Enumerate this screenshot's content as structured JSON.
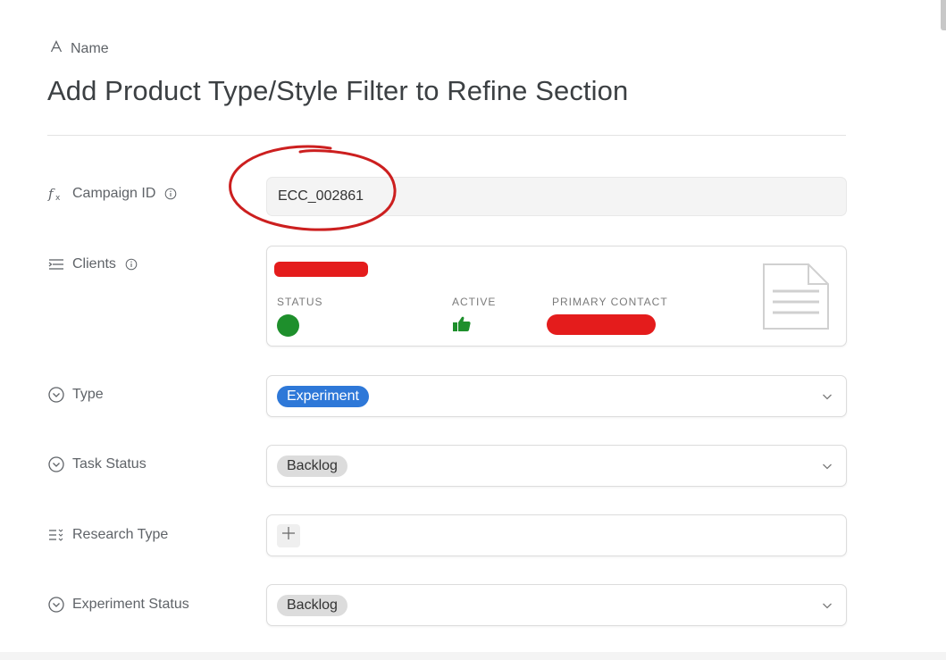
{
  "header": {
    "name_label": "Name",
    "name_icon": "text-a-icon",
    "title": "Add Product Type/Style Filter to Refine Section"
  },
  "fields": {
    "campaign_id": {
      "label": "Campaign ID",
      "icon": "formula-icon",
      "value": "ECC_002861"
    },
    "clients": {
      "label": "Clients",
      "icon": "relation-icon",
      "status_label": "STATUS",
      "active_label": "ACTIVE",
      "primary_contact_label": "PRIMARY CONTACT",
      "status_color": "#1e8f2c",
      "active_icon": "thumbs-up-icon"
    },
    "type": {
      "label": "Type",
      "icon": "circle-chevron-icon",
      "value": "Experiment",
      "pill_color": "#2e78d8"
    },
    "task_status": {
      "label": "Task Status",
      "icon": "circle-chevron-icon",
      "value": "Backlog"
    },
    "research_type": {
      "label": "Research Type",
      "icon": "multi-select-icon",
      "add_label": "+"
    },
    "experiment_status": {
      "label": "Experiment Status",
      "icon": "circle-chevron-icon",
      "value": "Backlog"
    }
  },
  "colors": {
    "annotation": "#cc1f1f",
    "redaction": "#e41c1c",
    "accent": "#2e78d8"
  }
}
